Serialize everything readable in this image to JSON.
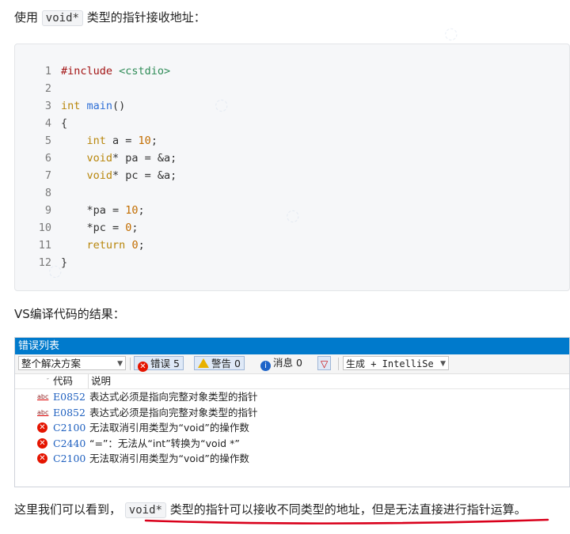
{
  "intro": {
    "prefix": "使用",
    "code": "void*",
    "suffix": "类型的指针接收地址："
  },
  "code_lines": [
    {
      "n": "1",
      "parts": [
        [
          "pp",
          "#include "
        ],
        [
          "inc",
          "<cstdio>"
        ]
      ]
    },
    {
      "n": "2",
      "parts": []
    },
    {
      "n": "3",
      "parts": [
        [
          "kw",
          "int "
        ],
        [
          "fn",
          "main"
        ],
        [
          "txt",
          "()"
        ]
      ]
    },
    {
      "n": "4",
      "parts": [
        [
          "txt",
          "{"
        ]
      ]
    },
    {
      "n": "5",
      "parts": [
        [
          "txt",
          "    "
        ],
        [
          "kw",
          "int"
        ],
        [
          "txt",
          " a = "
        ],
        [
          "num",
          "10"
        ],
        [
          "txt",
          ";"
        ]
      ]
    },
    {
      "n": "6",
      "parts": [
        [
          "txt",
          "    "
        ],
        [
          "kw",
          "void"
        ],
        [
          "txt",
          "* pa = &a;"
        ]
      ]
    },
    {
      "n": "7",
      "parts": [
        [
          "txt",
          "    "
        ],
        [
          "kw",
          "void"
        ],
        [
          "txt",
          "* pc = &a;"
        ]
      ]
    },
    {
      "n": "8",
      "parts": []
    },
    {
      "n": "9",
      "parts": [
        [
          "txt",
          "    *pa = "
        ],
        [
          "num",
          "10"
        ],
        [
          "txt",
          ";"
        ]
      ]
    },
    {
      "n": "10",
      "parts": [
        [
          "txt",
          "    *pc = "
        ],
        [
          "num",
          "0"
        ],
        [
          "txt",
          ";"
        ]
      ]
    },
    {
      "n": "11",
      "parts": [
        [
          "txt",
          "    "
        ],
        [
          "kw",
          "return"
        ],
        [
          "txt",
          " "
        ],
        [
          "num",
          "0"
        ],
        [
          "txt",
          ";"
        ]
      ]
    },
    {
      "n": "12",
      "parts": [
        [
          "txt",
          "}"
        ]
      ]
    }
  ],
  "vs_label": "VS编译代码的结果：",
  "error_list": {
    "title": "错误列表",
    "scope": "整个解决方案",
    "errors_label": "错误 5",
    "warnings_label": "警告 0",
    "messages_label": "消息 0",
    "build_filter": "生成 + IntelliSe",
    "col_code": "代码",
    "col_desc": "说明",
    "rows": [
      {
        "icon": "abc",
        "code": "E0852",
        "desc": "表达式必须是指向完整对象类型的指针"
      },
      {
        "icon": "abc",
        "code": "E0852",
        "desc": "表达式必须是指向完整对象类型的指针"
      },
      {
        "icon": "error",
        "code": "C2100",
        "desc": "无法取消引用类型为“void”的操作数"
      },
      {
        "icon": "error",
        "code": "C2440",
        "desc": "“=”：无法从“int”转换为“void *”"
      },
      {
        "icon": "error",
        "code": "C2100",
        "desc": "无法取消引用类型为“void”的操作数"
      }
    ]
  },
  "conclusion": {
    "prefix": "这里我们可以看到，",
    "code": "void*",
    "suffix": "类型的指针可以接收不同类型的地址，但是无法直接进行指针运算。"
  },
  "colors": {
    "accent": "#007acc",
    "underline": "#d9001b",
    "error": "#e51400"
  }
}
